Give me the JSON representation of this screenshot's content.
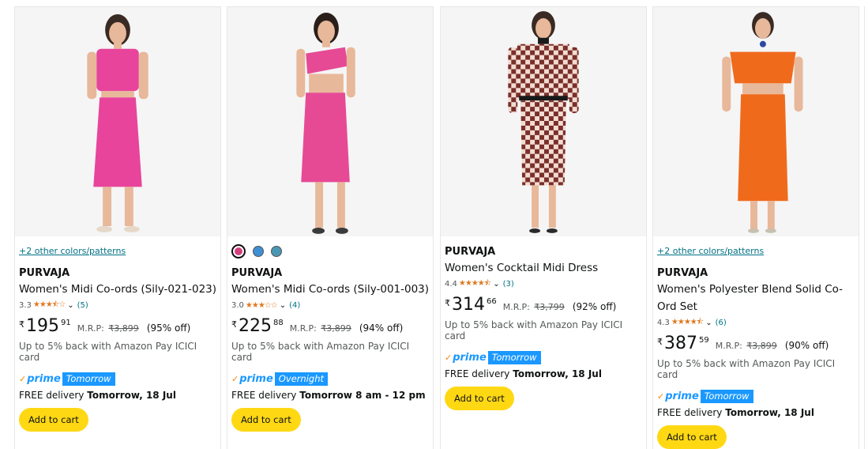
{
  "products": [
    {
      "colors_link": "+2 other colors/patterns",
      "brand": "PURVAJA",
      "title": "Women's Midi Co-ords (Sily-021-023)",
      "rating": "3.3",
      "stars": "★★★⯪☆",
      "reviews": "(5)",
      "currency": "₹",
      "price_whole": "195",
      "price_fraction": "91",
      "mrp_label": "M.R.P:",
      "mrp": "₹3,899",
      "discount": "(95% off)",
      "cashback": "Up to 5% back with Amazon Pay ICICI card",
      "prime": "prime",
      "prime_tag": "Tomorrow",
      "delivery_prefix": "FREE delivery",
      "delivery_date": "Tomorrow, 18 Jul",
      "cart_label": "Add to cart"
    },
    {
      "swatches": [
        "#d43f7d",
        "#3f8fd4",
        "#4a97b4"
      ],
      "brand": "PURVAJA",
      "title": "Women's Midi Co-ords (Sily-001-003)",
      "rating": "3.0",
      "stars": "★★★☆☆",
      "reviews": "(4)",
      "currency": "₹",
      "price_whole": "225",
      "price_fraction": "88",
      "mrp_label": "M.R.P:",
      "mrp": "₹3,899",
      "discount": "(94% off)",
      "cashback": "Up to 5% back with Amazon Pay ICICI card",
      "prime": "prime",
      "prime_tag": "Overnight",
      "delivery_prefix": "FREE delivery",
      "delivery_date": "Tomorrow 8 am - 12 pm",
      "cart_label": "Add to cart"
    },
    {
      "brand": "PURVAJA",
      "title": "Women's Cocktail Midi Dress",
      "rating": "4.4",
      "stars": "★★★★⯪",
      "reviews": "(3)",
      "currency": "₹",
      "price_whole": "314",
      "price_fraction": "66",
      "mrp_label": "M.R.P:",
      "mrp": "₹3,799",
      "discount": "(92% off)",
      "cashback": "Up to 5% back with Amazon Pay ICICI card",
      "prime": "prime",
      "prime_tag": "Tomorrow",
      "delivery_prefix": "FREE delivery",
      "delivery_date": "Tomorrow, 18 Jul",
      "cart_label": "Add to cart"
    },
    {
      "colors_link": "+2 other colors/patterns",
      "brand": "PURVAJA",
      "title": "Women's Polyester Blend Solid Co-Ord Set",
      "rating": "4.3",
      "stars": "★★★★⯪",
      "reviews": "(6)",
      "currency": "₹",
      "price_whole": "387",
      "price_fraction": "59",
      "mrp_label": "M.R.P:",
      "mrp": "₹3,899",
      "discount": "(90% off)",
      "cashback": "Up to 5% back with Amazon Pay ICICI card",
      "prime": "prime",
      "prime_tag": "Tomorrow",
      "delivery_prefix": "FREE delivery",
      "delivery_date": "Tomorrow, 18 Jul",
      "cart_label": "Add to cart"
    }
  ],
  "colors": {
    "link": "#007185",
    "star": "#de7921",
    "prime": "#1a98ff",
    "cart_button": "#ffd814",
    "outfit_1": "#e8449b",
    "outfit_2": "#e64a95",
    "outfit_3": "#7a2f2a",
    "outfit_4": "#f06a1c"
  }
}
